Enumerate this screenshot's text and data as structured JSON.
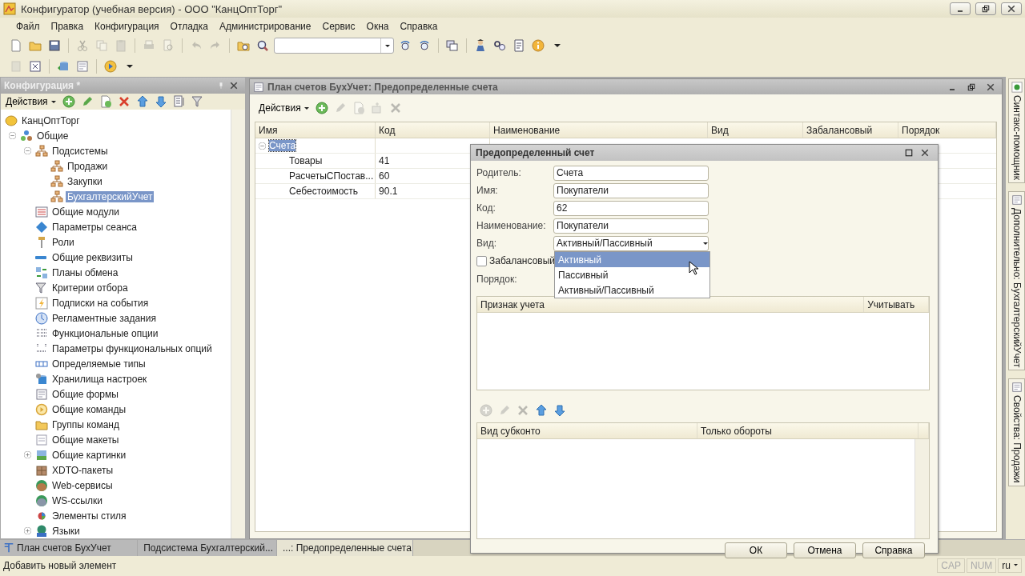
{
  "window": {
    "title": "Конфигуратор (учебная версия) - ООО \"КанцОптТорг\""
  },
  "menu": [
    {
      "label": "Файл"
    },
    {
      "label": "Правка"
    },
    {
      "label": "Конфигурация"
    },
    {
      "label": "Отладка"
    },
    {
      "label": "Администрирование"
    },
    {
      "label": "Сервис"
    },
    {
      "label": "Окна"
    },
    {
      "label": "Справка"
    }
  ],
  "toolbars": [
    [
      {
        "kind": "new",
        "disabled": false
      },
      {
        "kind": "open",
        "disabled": false
      },
      {
        "kind": "save",
        "disabled": false
      },
      {
        "kind": "separator"
      },
      {
        "kind": "cut",
        "disabled": true
      },
      {
        "kind": "copy",
        "disabled": true
      },
      {
        "kind": "paste",
        "disabled": true
      },
      {
        "kind": "separator"
      },
      {
        "kind": "print",
        "disabled": true
      },
      {
        "kind": "preview",
        "disabled": true
      },
      {
        "kind": "separator"
      },
      {
        "kind": "undo",
        "disabled": true
      },
      {
        "kind": "redo",
        "disabled": true
      },
      {
        "kind": "separator"
      },
      {
        "kind": "findfolder",
        "disabled": false
      },
      {
        "kind": "search",
        "disabled": false
      },
      {
        "kind": "searchbox"
      },
      {
        "kind": "findnext",
        "disabled": false
      },
      {
        "kind": "findprev",
        "disabled": false
      },
      {
        "kind": "separator"
      },
      {
        "kind": "windows",
        "disabled": false
      },
      {
        "kind": "separator"
      },
      {
        "kind": "assistant",
        "disabled": false
      },
      {
        "kind": "helpsearch",
        "disabled": false
      },
      {
        "kind": "notes",
        "disabled": false
      },
      {
        "kind": "info",
        "disabled": false
      },
      {
        "kind": "caret",
        "disabled": false
      }
    ],
    [
      {
        "kind": "module",
        "disabled": true
      },
      {
        "kind": "closewin",
        "disabled": false
      },
      {
        "kind": "separator"
      },
      {
        "kind": "db",
        "disabled": false
      },
      {
        "kind": "form",
        "disabled": false
      },
      {
        "kind": "separator"
      },
      {
        "kind": "run",
        "disabled": false
      },
      {
        "kind": "caret",
        "disabled": false
      }
    ]
  ],
  "config_panel": {
    "title": "Конфигурация *",
    "actions_label": "Действия",
    "toolbar": [
      {
        "kind": "add",
        "disabled": false
      },
      {
        "kind": "edit",
        "disabled": false
      },
      {
        "kind": "copyadd",
        "disabled": false
      },
      {
        "kind": "delete",
        "disabled": false
      },
      {
        "kind": "up",
        "disabled": false
      },
      {
        "kind": "down",
        "disabled": false
      },
      {
        "kind": "sort",
        "disabled": false
      },
      {
        "kind": "filter",
        "disabled": false
      }
    ],
    "tree": [
      {
        "label": "КанцОптТорг",
        "kind": "root",
        "selected": false,
        "children": [
          {
            "label": "Общие",
            "kind": "common",
            "selected": false,
            "expanded": true,
            "children": [
              {
                "label": "Подсистемы",
                "kind": "subsystem",
                "selected": false,
                "expanded": true,
                "children": [
                  {
                    "label": "Продажи",
                    "kind": "subsystem",
                    "selected": false
                  },
                  {
                    "label": "Закупки",
                    "kind": "subsystem",
                    "selected": false
                  },
                  {
                    "label": "БухгалтерскийУчет",
                    "kind": "subsystem",
                    "selected": true
                  }
                ]
              },
              {
                "label": "Общие модули",
                "kind": "modules",
                "selected": false
              },
              {
                "label": "Параметры сеанса",
                "kind": "session",
                "selected": false
              },
              {
                "label": "Роли",
                "kind": "roles",
                "selected": false
              },
              {
                "label": "Общие реквизиты",
                "kind": "attributes",
                "selected": false
              },
              {
                "label": "Планы обмена",
                "kind": "exchange",
                "selected": false
              },
              {
                "label": "Критерии отбора",
                "kind": "filter",
                "selected": false
              },
              {
                "label": "Подписки на события",
                "kind": "subscriptions",
                "selected": false
              },
              {
                "label": "Регламентные задания",
                "kind": "jobs",
                "selected": false
              },
              {
                "label": "Функциональные опции",
                "kind": "options",
                "selected": false
              },
              {
                "label": "Параметры функциональных опций",
                "kind": "optionparams",
                "selected": false
              },
              {
                "label": "Определяемые типы",
                "kind": "types",
                "selected": false
              },
              {
                "label": "Хранилища настроек",
                "kind": "storage",
                "selected": false
              },
              {
                "label": "Общие формы",
                "kind": "form",
                "selected": false
              },
              {
                "label": "Общие команды",
                "kind": "commands",
                "selected": false
              },
              {
                "label": "Группы команд",
                "kind": "open",
                "selected": false
              },
              {
                "label": "Общие макеты",
                "kind": "templates",
                "selected": false
              },
              {
                "label": "Общие картинки",
                "kind": "pictures",
                "selected": false,
                "expanded": false
              },
              {
                "label": "XDTO-пакеты",
                "kind": "xdto",
                "selected": false
              },
              {
                "label": "Web-сервисы",
                "kind": "web",
                "selected": false
              },
              {
                "label": "WS-ссылки",
                "kind": "ws",
                "selected": false
              },
              {
                "label": "Элементы стиля",
                "kind": "style",
                "selected": false
              },
              {
                "label": "Языки",
                "kind": "languages",
                "selected": false,
                "expanded": false
              }
            ]
          }
        ]
      }
    ]
  },
  "accounts_window": {
    "title": "План счетов БухУчет: Предопределенные счета",
    "actions_label": "Действия",
    "toolbar": [
      {
        "kind": "add",
        "disabled": false
      },
      {
        "kind": "edit",
        "disabled": true
      },
      {
        "kind": "copyadd",
        "disabled": true
      },
      {
        "kind": "move",
        "disabled": true
      },
      {
        "kind": "delete",
        "disabled": true
      }
    ],
    "columns": [
      "Имя",
      "Код",
      "Наименование",
      "Вид",
      "Забалансовый",
      "Порядок"
    ],
    "rows": [
      {
        "name": "Счета",
        "code": "",
        "selected": true,
        "expanded": true,
        "children": [
          {
            "name": "Товары",
            "code": "41",
            "selected": false
          },
          {
            "name": "РасчетыСПостав...",
            "code": "60",
            "selected": false
          },
          {
            "name": "Себестоимость",
            "code": "90.1",
            "selected": false
          }
        ]
      }
    ]
  },
  "dialog": {
    "title": "Предопределенный счет",
    "fields": [
      {
        "label": "Родитель:",
        "value": "Счета",
        "kind": "text"
      },
      {
        "label": "Имя:",
        "value": "Покупатели",
        "kind": "text"
      },
      {
        "label": "Код:",
        "value": "62",
        "kind": "text"
      },
      {
        "label": "Наименование:",
        "value": "Покупатели",
        "kind": "text"
      },
      {
        "label": "Вид:",
        "value": "Активный/Пассивный",
        "kind": "combo"
      }
    ],
    "dropdown": [
      {
        "label": "Активный",
        "selected": true
      },
      {
        "label": "Пассивный",
        "selected": false
      },
      {
        "label": "Активный/Пассивный",
        "selected": false
      }
    ],
    "checkbox": {
      "label": "Забалансовый",
      "checked": false
    },
    "order_label": "Порядок:",
    "flags_table": {
      "columns": [
        "Признак учета",
        "Учитывать"
      ]
    },
    "subconto_toolbar": [
      {
        "kind": "add",
        "disabled": true
      },
      {
        "kind": "edit",
        "disabled": true
      },
      {
        "kind": "delete",
        "disabled": true
      },
      {
        "kind": "up",
        "disabled": false
      },
      {
        "kind": "down",
        "disabled": false
      }
    ],
    "subconto_table": {
      "columns": [
        "Вид субконто",
        "Только обороты"
      ]
    },
    "buttons": [
      "ОК",
      "Отмена",
      "Справка"
    ]
  },
  "side_tabs": [
    {
      "label": "Синтакс-помощник"
    },
    {
      "label": "Дополнительно: БухгалтерскийУчет"
    },
    {
      "label": "Свойства: Продажи"
    }
  ],
  "taskbar": [
    {
      "label": "План счетов БухУчет",
      "selected": false
    },
    {
      "label": "Подсистема Бухгалтерский...",
      "selected": false
    },
    {
      "label": "...: Предопределенные счета",
      "selected": true
    }
  ],
  "status_bar": {
    "text": "Добавить новый элемент",
    "indicators": [
      "CAP",
      "NUM"
    ],
    "language": "ru"
  }
}
